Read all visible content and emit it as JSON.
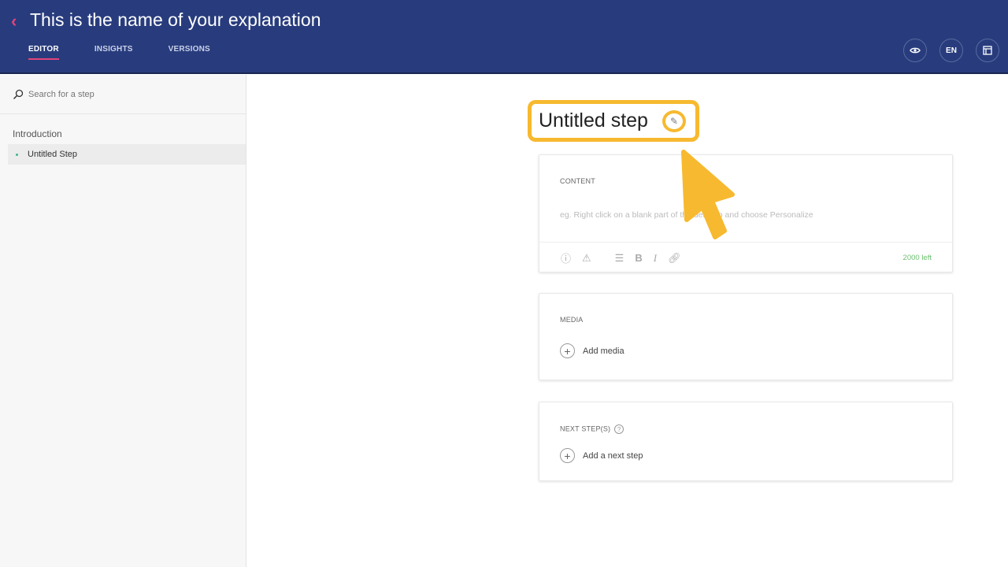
{
  "header": {
    "back_icon": "chevron-left-icon",
    "title": "This is the name of your explanation",
    "tabs": [
      {
        "label": "EDITOR",
        "active": true
      },
      {
        "label": "INSIGHTS"
      },
      {
        "label": "VERSIONS"
      }
    ],
    "buttons": {
      "preview_icon": "eye-icon",
      "language": "EN",
      "layout_icon": "layout-icon"
    },
    "accent": "#e0457b",
    "background": "#283c7d"
  },
  "sidebar": {
    "search_placeholder": "Search for a step",
    "section": "Introduction",
    "items": [
      {
        "label": "Untitled Step"
      }
    ]
  },
  "main": {
    "step_title": "Untitled step",
    "highlight_color": "#f7b92f",
    "content": {
      "label": "CONTENT",
      "placeholder": "eg. Right click on a blank part of the desktop and choose Personalize",
      "chars_left": "2000 left"
    },
    "media": {
      "label": "MEDIA",
      "add": "Add media"
    },
    "next": {
      "label": "NEXT STEP(S)",
      "add": "Add a next step"
    }
  }
}
